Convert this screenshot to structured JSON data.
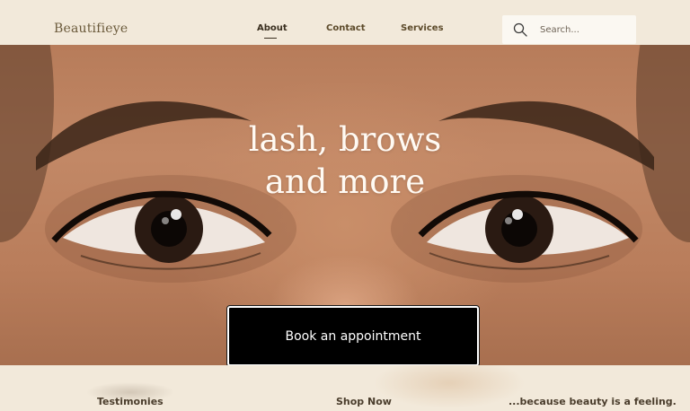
{
  "brand": {
    "logo": "Beautifieye"
  },
  "nav": {
    "about": "About",
    "contact": "Contact",
    "services": "Services"
  },
  "search": {
    "placeholder": "Search..."
  },
  "hero": {
    "headline_line1": "lash, brows",
    "headline_line2": "and more",
    "cta_label": "Book an appointment"
  },
  "footer": {
    "testimonies": "Testimonies",
    "shop_now": "Shop Now",
    "tagline": "...because beauty is a feeling."
  },
  "colors": {
    "background": "#f2e9da",
    "nav_text": "#5c4a2a",
    "cta_background": "#000000",
    "headline_text": "#fffaf3"
  }
}
